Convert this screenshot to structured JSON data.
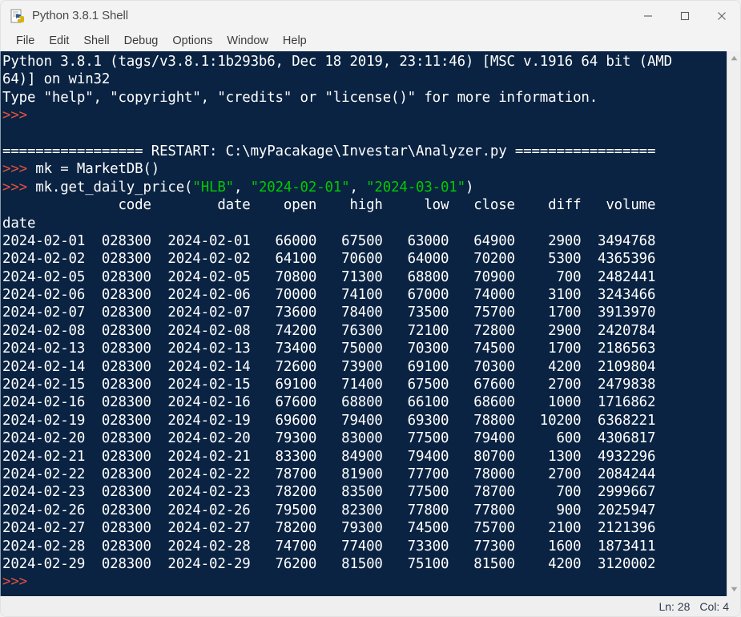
{
  "window": {
    "title": "Python 3.8.1 Shell",
    "icon": "python-idle-icon",
    "controls": [
      {
        "name": "minimize-button",
        "glyph": "minimize-icon"
      },
      {
        "name": "maximize-button",
        "glyph": "maximize-icon"
      },
      {
        "name": "close-button",
        "glyph": "close-icon"
      }
    ]
  },
  "menubar": {
    "items": [
      {
        "label": "File"
      },
      {
        "label": "Edit"
      },
      {
        "label": "Shell"
      },
      {
        "label": "Debug"
      },
      {
        "label": "Options"
      },
      {
        "label": "Window"
      },
      {
        "label": "Help"
      }
    ]
  },
  "colors": {
    "console_background": "#0a2342",
    "console_text": "#ffffff",
    "prompt": "#e0513f",
    "string_literal": "#00c900",
    "chrome": "#f3f3f3",
    "statusbar": "#efefef"
  },
  "console": {
    "banner": [
      "Python 3.8.1 (tags/v3.8.1:1b293b6, Dec 18 2019, 23:11:46) [MSC v.1916 64 bit (AMD",
      "64)] on win32",
      "Type \"help\", \"copyright\", \"credits\" or \"license()\" for more information."
    ],
    "prompt_symbol": ">>>",
    "restart_line": "================= RESTART: C:\\myPacakage\\Investar\\Analyzer.py =================",
    "commands": [
      {
        "prompt": ">>> ",
        "text": "mk = MarketDB()"
      }
    ],
    "call": {
      "prompt": ">>> ",
      "prefix": "mk.get_daily_price(",
      "arg1": "\"HLB\"",
      "sep1": ", ",
      "arg2": "\"2024-02-01\"",
      "sep2": ", ",
      "arg3": "\"2024-03-01\"",
      "suffix": ")"
    },
    "table": {
      "header": "              code        date    open    high     low   close    diff   volume",
      "index_name": "date",
      "columns": [
        "code",
        "date",
        "open",
        "high",
        "low",
        "close",
        "diff",
        "volume"
      ],
      "index_label": "date",
      "rows": [
        {
          "index": "2024-02-01",
          "code": "028300",
          "date": "2024-02-01",
          "open": "66000",
          "high": "67500",
          "low": "63000",
          "close": "64900",
          "diff": "2900",
          "volume": "3494768"
        },
        {
          "index": "2024-02-02",
          "code": "028300",
          "date": "2024-02-02",
          "open": "64100",
          "high": "70600",
          "low": "64000",
          "close": "70200",
          "diff": "5300",
          "volume": "4365396"
        },
        {
          "index": "2024-02-05",
          "code": "028300",
          "date": "2024-02-05",
          "open": "70800",
          "high": "71300",
          "low": "68800",
          "close": "70900",
          "diff": "700",
          "volume": "2482441"
        },
        {
          "index": "2024-02-06",
          "code": "028300",
          "date": "2024-02-06",
          "open": "70000",
          "high": "74100",
          "low": "67000",
          "close": "74000",
          "diff": "3100",
          "volume": "3243466"
        },
        {
          "index": "2024-02-07",
          "code": "028300",
          "date": "2024-02-07",
          "open": "73600",
          "high": "78400",
          "low": "73500",
          "close": "75700",
          "diff": "1700",
          "volume": "3913970"
        },
        {
          "index": "2024-02-08",
          "code": "028300",
          "date": "2024-02-08",
          "open": "74200",
          "high": "76300",
          "low": "72100",
          "close": "72800",
          "diff": "2900",
          "volume": "2420784"
        },
        {
          "index": "2024-02-13",
          "code": "028300",
          "date": "2024-02-13",
          "open": "73400",
          "high": "75000",
          "low": "70300",
          "close": "74500",
          "diff": "1700",
          "volume": "2186563"
        },
        {
          "index": "2024-02-14",
          "code": "028300",
          "date": "2024-02-14",
          "open": "72600",
          "high": "73900",
          "low": "69100",
          "close": "70300",
          "diff": "4200",
          "volume": "2109804"
        },
        {
          "index": "2024-02-15",
          "code": "028300",
          "date": "2024-02-15",
          "open": "69100",
          "high": "71400",
          "low": "67500",
          "close": "67600",
          "diff": "2700",
          "volume": "2479838"
        },
        {
          "index": "2024-02-16",
          "code": "028300",
          "date": "2024-02-16",
          "open": "67600",
          "high": "68800",
          "low": "66100",
          "close": "68600",
          "diff": "1000",
          "volume": "1716862"
        },
        {
          "index": "2024-02-19",
          "code": "028300",
          "date": "2024-02-19",
          "open": "69600",
          "high": "79400",
          "low": "69300",
          "close": "78800",
          "diff": "10200",
          "volume": "6368221"
        },
        {
          "index": "2024-02-20",
          "code": "028300",
          "date": "2024-02-20",
          "open": "79300",
          "high": "83000",
          "low": "77500",
          "close": "79400",
          "diff": "600",
          "volume": "4306817"
        },
        {
          "index": "2024-02-21",
          "code": "028300",
          "date": "2024-02-21",
          "open": "83300",
          "high": "84900",
          "low": "79400",
          "close": "80700",
          "diff": "1300",
          "volume": "4932296"
        },
        {
          "index": "2024-02-22",
          "code": "028300",
          "date": "2024-02-22",
          "open": "78700",
          "high": "81900",
          "low": "77700",
          "close": "78000",
          "diff": "2700",
          "volume": "2084244"
        },
        {
          "index": "2024-02-23",
          "code": "028300",
          "date": "2024-02-23",
          "open": "78200",
          "high": "83500",
          "low": "77500",
          "close": "78700",
          "diff": "700",
          "volume": "2999667"
        },
        {
          "index": "2024-02-26",
          "code": "028300",
          "date": "2024-02-26",
          "open": "79500",
          "high": "82300",
          "low": "77800",
          "close": "77800",
          "diff": "900",
          "volume": "2025947"
        },
        {
          "index": "2024-02-27",
          "code": "028300",
          "date": "2024-02-27",
          "open": "78200",
          "high": "79300",
          "low": "74500",
          "close": "75700",
          "diff": "2100",
          "volume": "2121396"
        },
        {
          "index": "2024-02-28",
          "code": "028300",
          "date": "2024-02-28",
          "open": "74700",
          "high": "77400",
          "low": "73300",
          "close": "77300",
          "diff": "1600",
          "volume": "1873411"
        },
        {
          "index": "2024-02-29",
          "code": "028300",
          "date": "2024-02-29",
          "open": "76200",
          "high": "81500",
          "low": "75100",
          "close": "81500",
          "diff": "4200",
          "volume": "3120002"
        }
      ]
    }
  },
  "scrollbar": {
    "up_arrow": "scroll-up-icon",
    "down_arrow": "scroll-down-icon"
  },
  "statusbar": {
    "line": "Ln: 28",
    "column": "Col: 4"
  }
}
